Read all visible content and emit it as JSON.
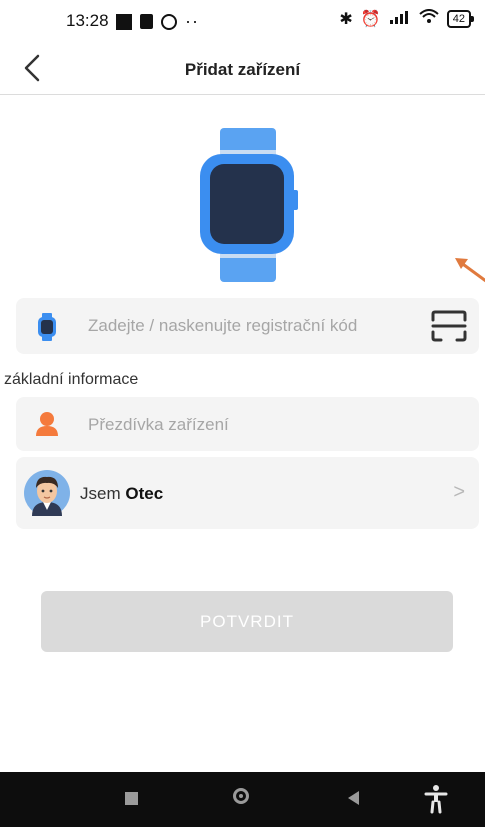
{
  "status_bar": {
    "time": "13:28",
    "battery": "42",
    "icons": [
      "notification-square-icon",
      "sim-icon",
      "location-icon",
      "bluetooth-icon",
      "alarm-icon",
      "signal-icon",
      "wifi-icon",
      "battery-icon"
    ],
    "more": "··"
  },
  "header": {
    "title": "Přidat zařízení",
    "back_icon": "chevron-left-icon"
  },
  "registration": {
    "placeholder": "Zadejte / naskenujte registrační kód",
    "icon": "watch-icon",
    "scan_icon": "scan-frame-icon"
  },
  "section": {
    "label": "základní informace"
  },
  "nickname": {
    "placeholder": "Přezdívka zařízení",
    "icon": "person-icon"
  },
  "role": {
    "prefix": "Jsem",
    "value": "Otec",
    "chevron": ">",
    "avatar": "father-avatar-icon"
  },
  "confirm_button": {
    "label": "POTVRDIT"
  },
  "colors": {
    "accent_blue": "#3b8ef0",
    "accent_orange": "#f47a3c",
    "button_disabled": "#dadada"
  },
  "nav_bar": {
    "icons": [
      "recent-apps-icon",
      "home-icon",
      "back-icon",
      "accessibility-icon"
    ]
  }
}
